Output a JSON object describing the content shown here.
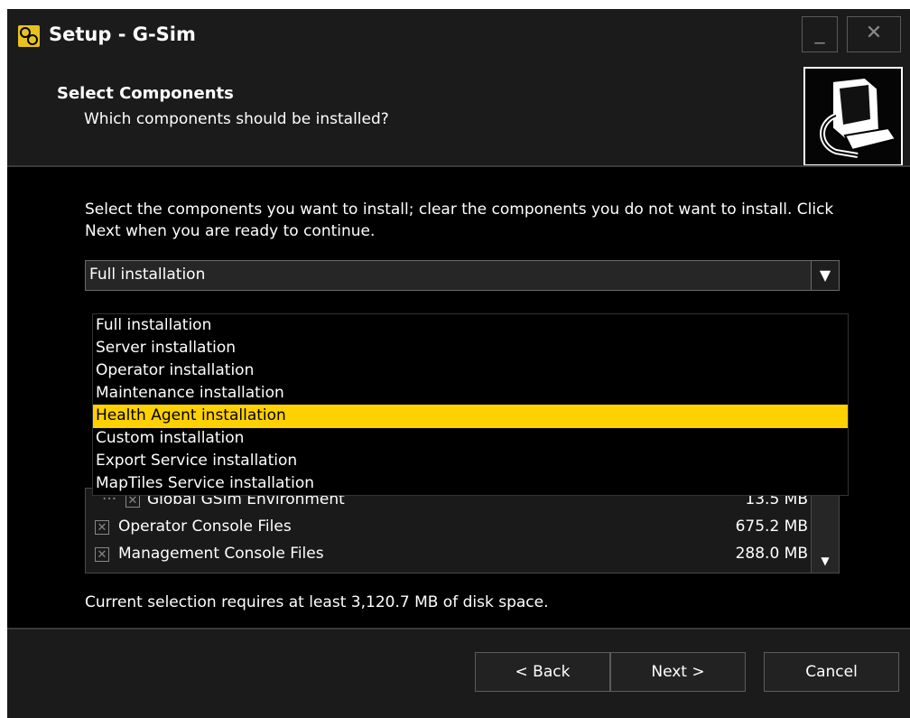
{
  "window": {
    "title": "Setup - G-Sim",
    "minimize_label": "_",
    "close_label": "✕"
  },
  "header": {
    "title": "Select Components",
    "subtitle": "Which components should be installed?"
  },
  "content": {
    "instructions": "Select the components you want to install; clear the components you do not want to install. Click Next when you are ready to continue.",
    "combo_value": "Full installation",
    "combo_arrow": "▼",
    "dropdown_options": [
      "Full installation",
      "Server installation",
      "Operator installation",
      "Maintenance installation",
      "Health Agent installation",
      "Custom installation",
      "Export Service installation",
      "MapTiles Service installation"
    ],
    "dropdown_highlighted": "Health Agent installation",
    "components": [
      {
        "label": "Global GSim Environment",
        "size": "13.5 MB",
        "check": "✕",
        "indent_marker": "···"
      },
      {
        "label": "Operator Console Files",
        "size": "675.2 MB",
        "check": "✕"
      },
      {
        "label": "Management Console Files",
        "size": "288.0 MB",
        "check": "✕"
      }
    ],
    "scroll_down": "▼",
    "disk_space": "Current selection requires at least 3,120.7 MB of disk space."
  },
  "buttons": {
    "back": "< Back",
    "next": "Next >",
    "cancel": "Cancel"
  },
  "colors": {
    "highlight": "#ffd100",
    "window_bg": "#1b1b1b",
    "content_bg": "#000000"
  }
}
